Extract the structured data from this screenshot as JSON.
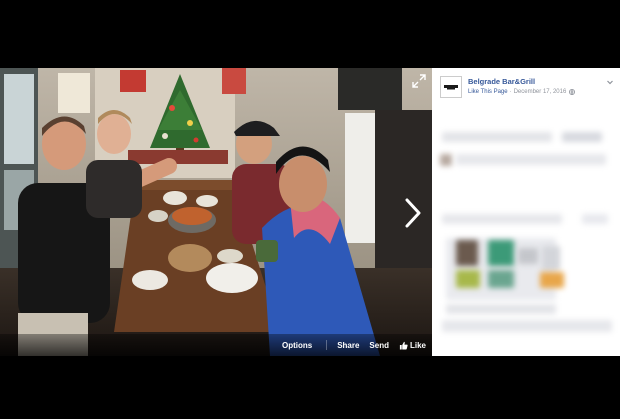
{
  "page": {
    "name": "Belgrade Bar&Grill",
    "like_link": "Like This Page",
    "separator": "·",
    "date": "December 17, 2016"
  },
  "actions": {
    "options": "Options",
    "share": "Share",
    "send": "Send",
    "like": "Like"
  },
  "colors": {
    "link": "#365899",
    "meta": "#90949c",
    "backdrop": "#000000"
  },
  "icons": [
    "expand-icon",
    "next-arrow-icon",
    "like-icon",
    "globe-icon",
    "chevron-down-icon",
    "page-logo-icon"
  ]
}
